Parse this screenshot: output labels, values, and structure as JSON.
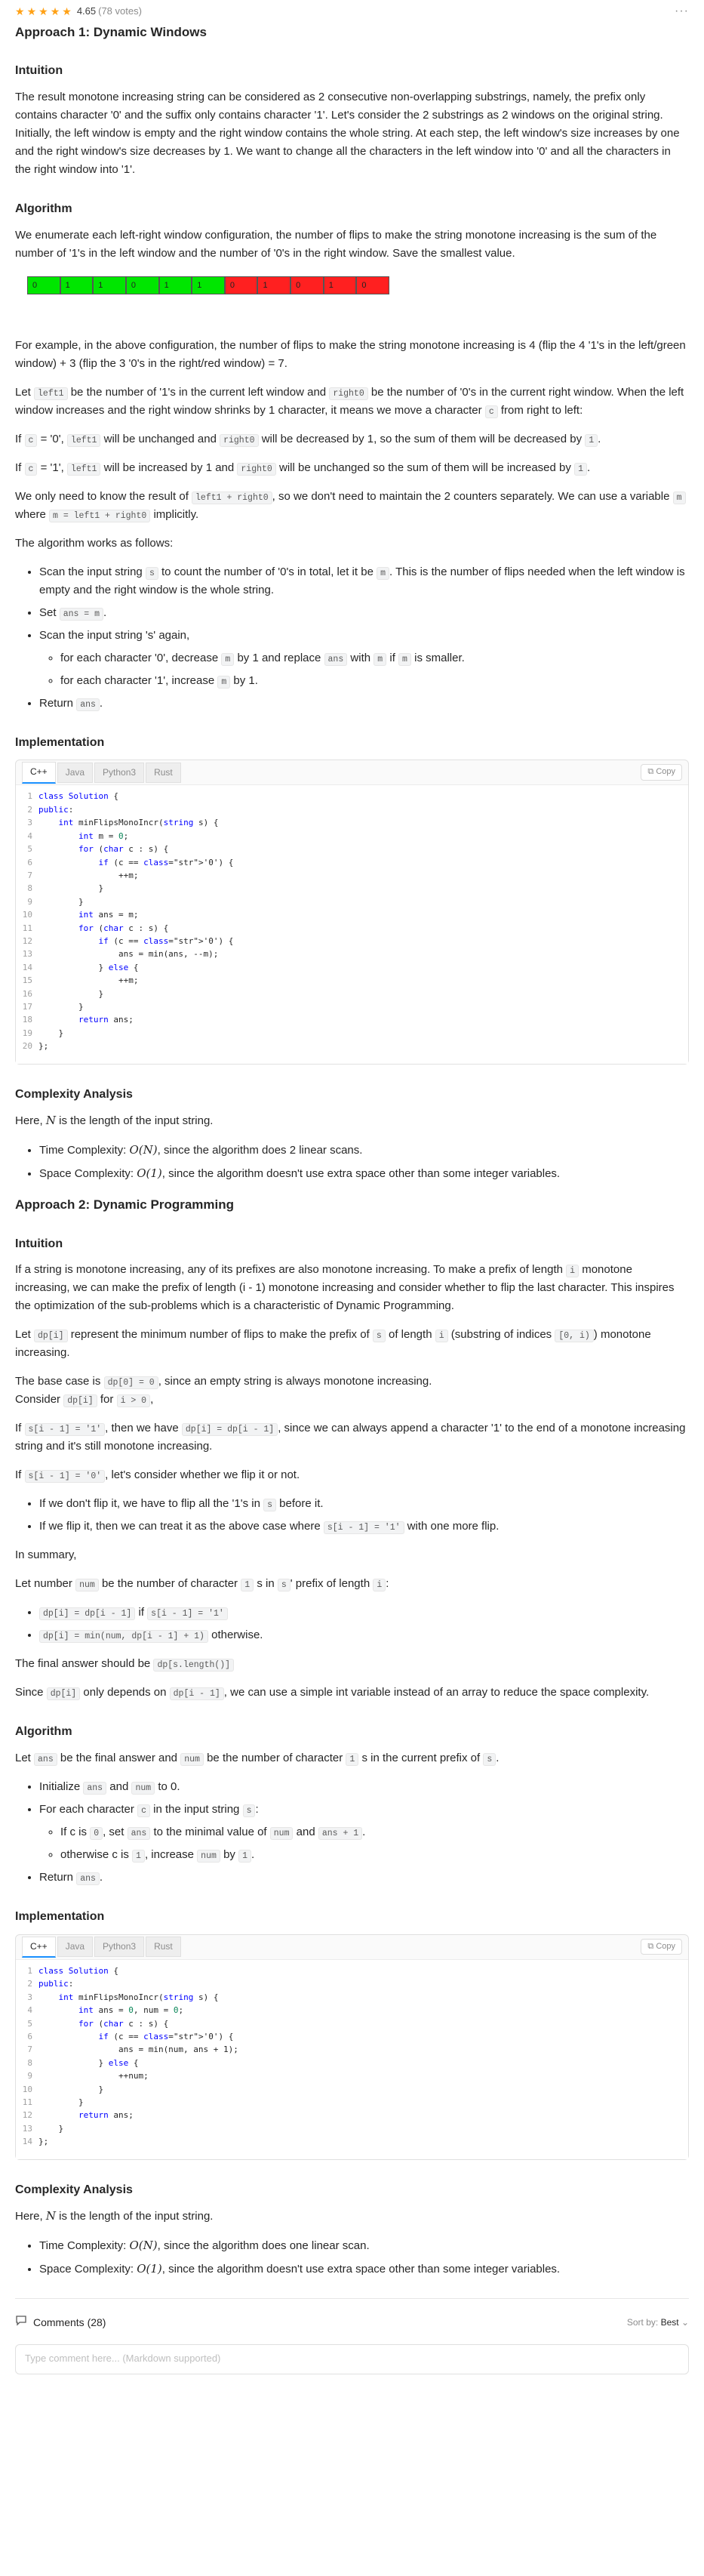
{
  "header": {
    "rating": "4.65",
    "votes": "(78 votes)",
    "more": "···"
  },
  "a1": {
    "title": "Approach 1: Dynamic Windows",
    "intuition_h": "Intuition",
    "intuition": "The result monotone increasing string can be considered as 2 consecutive non-overlapping substrings, namely, the prefix only contains character '0' and the suffix only contains character '1'. Let's consider the 2 substrings as 2 windows on the original string. Initially, the left window is empty and the right window contains the whole string. At each step, the left window's size increases by one and the right window's size decreases by 1. We want to change all the characters in the left window into '0' and all the characters in the right window into '1'.",
    "algorithm_h": "Algorithm",
    "algorithm": "We enumerate each left-right window configuration, the number of flips to make the string monotone increasing is the sum of the number of '1's in the left window and the number of '0's in the right window. Save the smallest value.",
    "cells": [
      "0",
      "1",
      "1",
      "0",
      "1",
      "1",
      "0",
      "1",
      "0",
      "1",
      "0"
    ],
    "example": "For example, in the above configuration, the number of flips to make the string monotone increasing is 4 (flip the 4 '1's in the left/green window) + 3 (flip the 3 '0's in the right/red window) = 7.",
    "let_a": "Let",
    "left1": "left1",
    "let_b": "be the number of '1's in the current left window and",
    "right0": "right0",
    "let_c": "be the number of '0's in the current right window. When the left window increases and the right window shrinks by 1 character, it means we move a character",
    "c": "c",
    "let_d": "from right to left:",
    "if0_a": "If",
    "if0_b": "= '0',",
    "if0_c": "will be unchanged and",
    "if0_d": "will be decreased by 1, so the sum of them will be decreased by",
    "one": "1",
    "dot": ".",
    "if1_b": "= '1',",
    "if1_c": "will be increased by 1 and",
    "if1_d": "will be unchanged so the sum of them will be increased by",
    "only_a": "We only need to know the result of",
    "sumexpr": "left1 + right0",
    "only_b": ", so we don't need to maintain the 2 counters separately. We can use a variable",
    "m": "m",
    "only_c": "where",
    "mexpr": "m = left1 + right0",
    "only_d": "implicitly.",
    "works": "The algorithm works as follows:",
    "s1_a": "Scan the input string",
    "s": "s",
    "s1_b": "to count the number of '0's in total, let it be",
    "s1_c": ". This is the number of flips needed when the left window is empty and the right window is the whole string.",
    "s2_a": "Set",
    "ansm": "ans = m",
    "s3": "Scan the input string 's' again,",
    "s3a_a": "for each character '0', decrease",
    "s3a_b": "by 1 and replace",
    "ans": "ans",
    "s3a_c": "with",
    "s3a_d": "if",
    "s3a_e": "is smaller.",
    "s3b_a": "for each character '1', increase",
    "s3b_b": "by 1.",
    "s4": "Return",
    "impl_h": "Implementation",
    "complexity_h": "Complexity Analysis",
    "here_a": "Here,",
    "N": "N",
    "here_b": "is the length of the input string.",
    "time_a": "Time Complexity:",
    "ON": "O(N)",
    "time_b": ", since the algorithm does 2 linear scans.",
    "space_a": "Space Complexity:",
    "O1": "O(1)",
    "space_b": ", since the algorithm doesn't use extra space other than some integer variables."
  },
  "a2": {
    "title": "Approach 2: Dynamic Programming",
    "intuition_h": "Intuition",
    "p1_a": "If a string is monotone increasing, any of its prefixes are also monotone increasing. To make a prefix of length",
    "i": "i",
    "p1_b": "monotone increasing, we can make the prefix of length (i - 1) monotone increasing and consider whether to flip the last character. This inspires the optimization of the sub-problems which is a characteristic of Dynamic Programming.",
    "p2_a": "Let",
    "dpi": "dp[i]",
    "p2_b": "represent the minimum number of flips to make the prefix of",
    "s": "s",
    "p2_c": "of length",
    "p2_d": "(substring of indices",
    "range": "[0, i)",
    "p2_e": ") monotone increasing.",
    "p3_a": "The base case is",
    "dp0": "dp[0] = 0",
    "p3_b": ", since an empty string is always monotone increasing.",
    "p3_c": "Consider",
    "p3_d": "for",
    "igt0": "i > 0",
    "comma": ",",
    "p4_a": "If",
    "si1": "s[i - 1] = '1'",
    "p4_b": ", then we have",
    "dpeq": "dp[i] = dp[i - 1]",
    "p4_c": ", since we can always append a character '1' to the end of a monotone increasing string and it's still monotone increasing.",
    "p5_a": "If",
    "si0": "s[i - 1] = '0'",
    "p5_b": ", let's consider whether we flip it or not.",
    "b1_a": "If we don't flip it, we have to flip all the '1's in",
    "b1_b": "before it.",
    "b2_a": "If we flip it, then we can treat it as the above case where",
    "b2_b": "with one more flip.",
    "summary": "In summary,",
    "p6_a": "Let number",
    "num": "num",
    "p6_b": "be the number of character",
    "one": "1",
    "p6_c": "s in",
    "p6_d": "' prefix of length",
    "colon": ":",
    "r1_a": "dp[i] = dp[i - 1]",
    "r1_b": "if",
    "r1_c": "s[i - 1] = '1'",
    "r2_a": "dp[i] = min(num, dp[i - 1] + 1)",
    "r2_b": "otherwise.",
    "final_a": "The final answer should be",
    "final_b": "dp[s.length()]",
    "since_a": "Since",
    "since_b": "only depends on",
    "dpim1": "dp[i - 1]",
    "since_c": ", we can use a simple int variable instead of an array to reduce the space complexity.",
    "algorithm_h": "Algorithm",
    "alg_a": "Let",
    "ans": "ans",
    "alg_b": "be the final answer and",
    "alg_c": "be the number of character",
    "alg_d": "s in the current prefix of",
    "dot": ".",
    "l1_a": "Initialize",
    "l1_b": "and",
    "l1_c": "to 0.",
    "l2_a": "For each character",
    "c": "c",
    "l2_b": "in the input string",
    "l2a_a": "If c is",
    "zero": "0",
    "l2a_b": ", set",
    "l2a_c": "to the minimal value of",
    "l2a_d": "and",
    "ans1": "ans + 1",
    "l2b_a": "otherwise c is",
    "l2b_b": ", increase",
    "l2b_c": "by",
    "l3": "Return",
    "impl_h": "Implementation",
    "complexity_h": "Complexity Analysis",
    "here_a": "Here,",
    "N": "N",
    "here_b": "is the length of the input string.",
    "time_a": "Time Complexity:",
    "ON": "O(N)",
    "time_b": ", since the algorithm does one linear scan.",
    "space_a": "Space Complexity:",
    "O1": "O(1)",
    "space_b": ", since the algorithm doesn't use extra space other than some integer variables."
  },
  "code_tabs": [
    "C++",
    "Java",
    "Python3",
    "Rust"
  ],
  "copy_label": "Copy",
  "code1": [
    "class Solution {",
    "public:",
    "    int minFlipsMonoIncr(string s) {",
    "        int m = 0;",
    "        for (char c : s) {",
    "            if (c == '0') {",
    "                ++m;",
    "            }",
    "        }",
    "        int ans = m;",
    "        for (char c : s) {",
    "            if (c == '0') {",
    "                ans = min(ans, --m);",
    "            } else {",
    "                ++m;",
    "            }",
    "        }",
    "        return ans;",
    "    }",
    "};"
  ],
  "code2": [
    "class Solution {",
    "public:",
    "    int minFlipsMonoIncr(string s) {",
    "        int ans = 0, num = 0;",
    "        for (char c : s) {",
    "            if (c == '0') {",
    "                ans = min(num, ans + 1);",
    "            } else {",
    "                ++num;",
    "            }",
    "        }",
    "        return ans;",
    "    }",
    "};"
  ],
  "comments": {
    "label": "Comments (28)",
    "sort_label": "Sort by:",
    "sort_value": "Best",
    "placeholder": "Type comment here... (Markdown supported)"
  }
}
